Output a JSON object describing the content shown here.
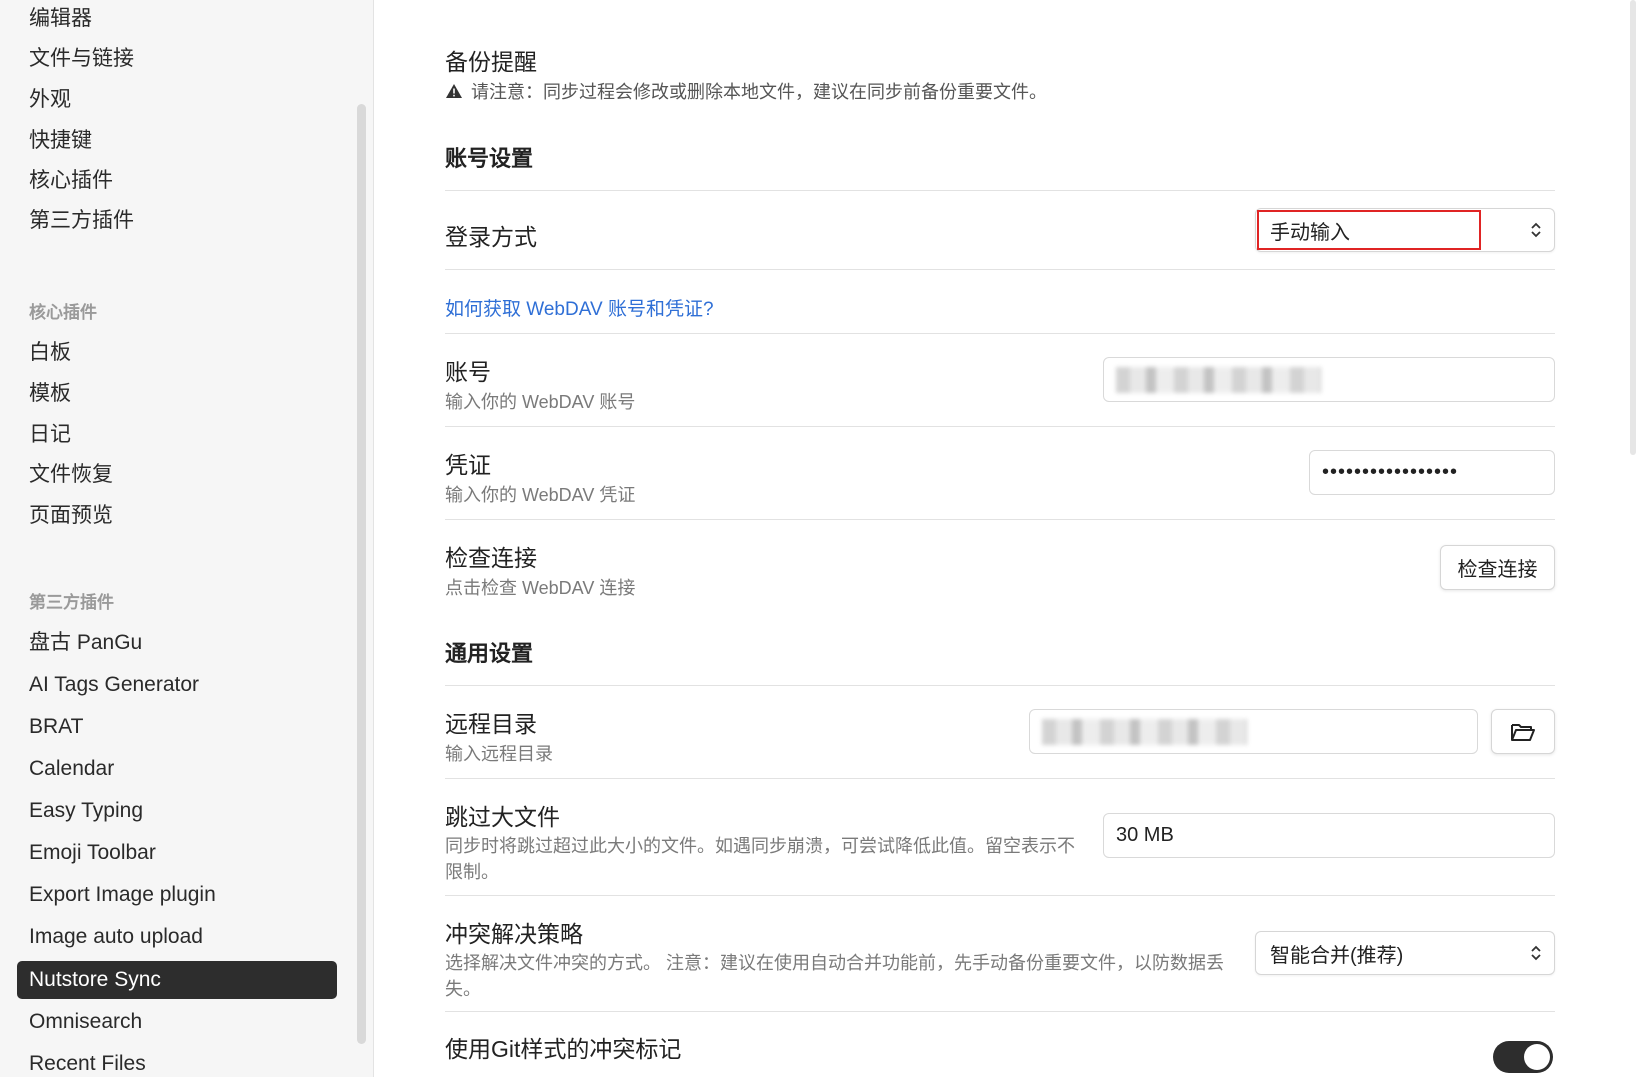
{
  "sidebar": {
    "top_items": [
      {
        "label": "编辑器"
      },
      {
        "label": "文件与链接"
      },
      {
        "label": "外观"
      },
      {
        "label": "快捷键"
      },
      {
        "label": "核心插件"
      },
      {
        "label": "第三方插件"
      }
    ],
    "core_heading": "核心插件",
    "core_items": [
      {
        "label": "白板"
      },
      {
        "label": "模板"
      },
      {
        "label": "日记"
      },
      {
        "label": "文件恢复"
      },
      {
        "label": "页面预览"
      }
    ],
    "third_heading": "第三方插件",
    "third_items": [
      {
        "label": "盘古 PanGu"
      },
      {
        "label": "AI Tags Generator"
      },
      {
        "label": "BRAT"
      },
      {
        "label": "Calendar"
      },
      {
        "label": "Easy Typing"
      },
      {
        "label": "Emoji Toolbar"
      },
      {
        "label": "Export Image plugin"
      },
      {
        "label": "Image auto upload"
      },
      {
        "label": "Nutstore Sync",
        "active": true
      },
      {
        "label": "Omnisearch"
      },
      {
        "label": "Recent Files"
      }
    ]
  },
  "backup": {
    "title": "备份提醒",
    "warning": "请注意：同步过程会修改或删除本地文件，建议在同步前备份重要文件。"
  },
  "account_section": {
    "title": "账号设置",
    "login_label": "登录方式",
    "login_value": "手动输入",
    "help_link": "如何获取 WebDAV 账号和凭证?",
    "account_label": "账号",
    "account_desc": "输入你的 WebDAV 账号",
    "credential_label": "凭证",
    "credential_desc": "输入你的 WebDAV 凭证",
    "credential_value": "•••••••••••••••••",
    "check_label": "检查连接",
    "check_desc": "点击检查 WebDAV 连接",
    "check_button": "检查连接"
  },
  "general_section": {
    "title": "通用设置",
    "remote_label": "远程目录",
    "remote_desc": "输入远程目录",
    "skip_label": "跳过大文件",
    "skip_desc_1": "同步时将跳过超过此大小的文件。如遇同步崩溃，可尝试降低此值。留空表示不",
    "skip_desc_2": "限制。",
    "skip_value": "30 MB",
    "conflict_label": "冲突解决策略",
    "conflict_desc_1": "选择解决文件冲突的方式。 注意：建议在使用自动合并功能前，先手动备份重要文件，以防数据丢",
    "conflict_desc_2": "失。",
    "conflict_value": "智能合并(推荐)",
    "git_label": "使用Git样式的冲突标记",
    "git_toggle_on": true
  },
  "colors": {
    "accent_link": "#2f6fd6",
    "active_nav_bg": "#2d2d2d",
    "highlight_border": "#e02424"
  }
}
